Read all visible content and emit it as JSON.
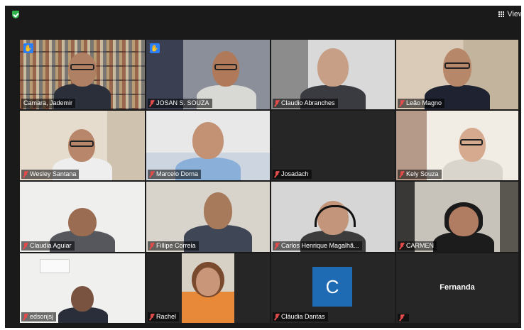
{
  "toolbar": {
    "view_label": "View"
  },
  "participants": [
    {
      "name": "Camara, Jademir",
      "active": true,
      "hand": true
    },
    {
      "name": "JOSAN S. SOUZA",
      "hand": true
    },
    {
      "name": "Claudio Abranches"
    },
    {
      "name": "Leão Magno"
    },
    {
      "name": "Wesley Santana"
    },
    {
      "name": "Marcelo Dorna"
    },
    {
      "name": "Josadach"
    },
    {
      "name": "Kely Souza"
    },
    {
      "name": "Claudia Aguiar"
    },
    {
      "name": "Fillipe Correia"
    },
    {
      "name": "Carlos Henrique Magalhã..."
    },
    {
      "name": "CARMEN"
    },
    {
      "name": "edsonjsj"
    },
    {
      "name": "Rachel"
    },
    {
      "name": "Cláudia Dantas",
      "avatar_letter": "C"
    },
    {
      "name": "",
      "display_name": "Fernanda"
    }
  ],
  "colors": {
    "active_border": "#d6e24a",
    "avatar_bg": "#1f6bb3",
    "muted": "#e34b4b",
    "shield": "#2fb24a"
  }
}
